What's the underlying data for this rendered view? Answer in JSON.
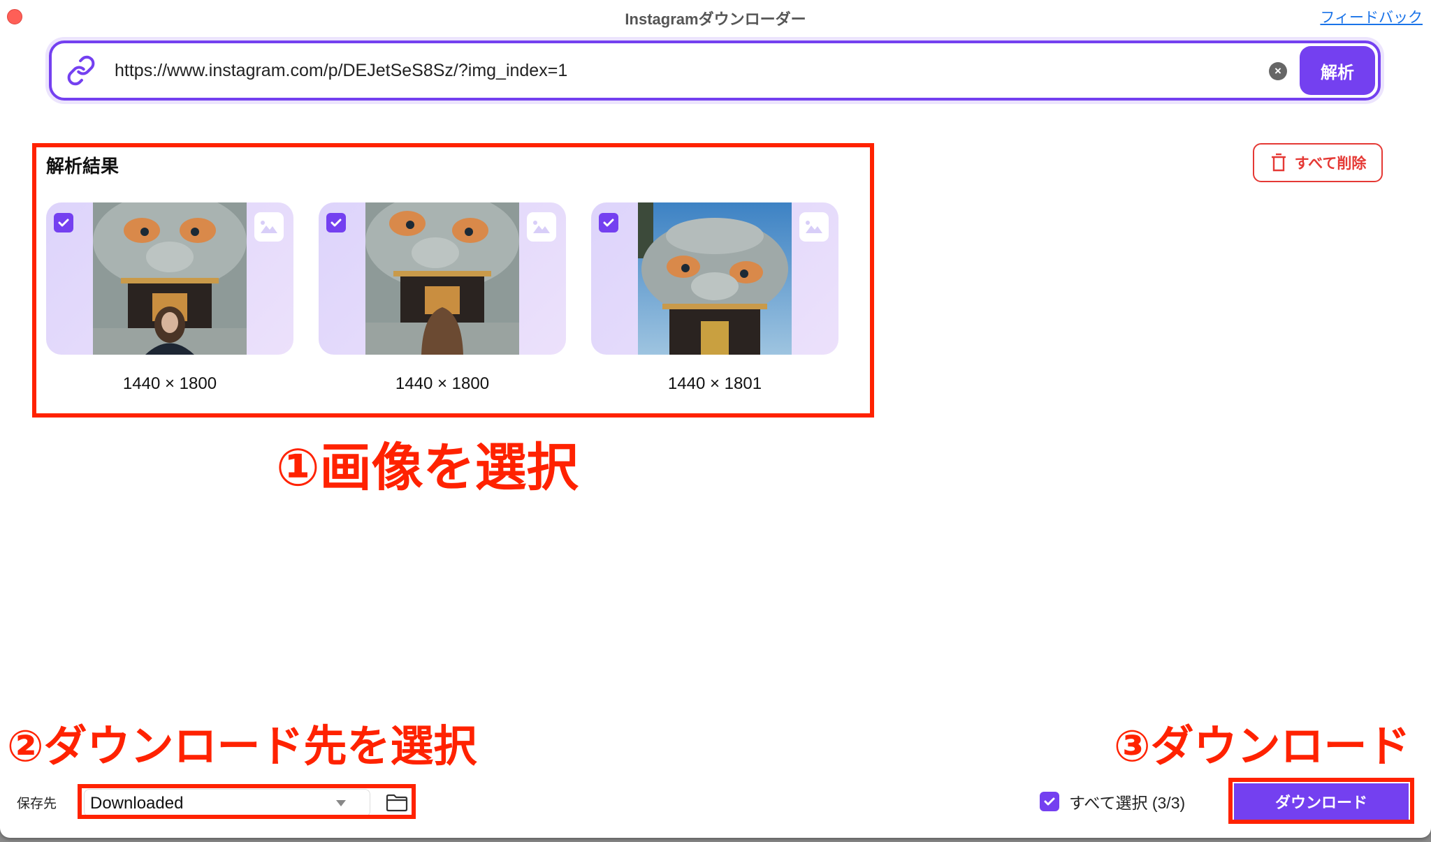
{
  "window": {
    "title": "Instagramダウンローダー",
    "feedback_link": "フィードバック"
  },
  "url_bar": {
    "icon": "link-icon",
    "value": "https://www.instagram.com/p/DEJetSeS8Sz/?img_index=1",
    "clear_icon": "clear-icon",
    "analyze_label": "解析"
  },
  "results": {
    "title": "解析結果",
    "delete_all_label": "すべて削除",
    "delete_icon": "trash-icon",
    "items": [
      {
        "dimensions": "1440 × 1800",
        "checked": true,
        "type_icon": "image-icon",
        "subject": "shishi lion-head shrine with woman facing camera"
      },
      {
        "dimensions": "1440 × 1800",
        "checked": true,
        "type_icon": "image-icon",
        "subject": "shishi lion-head shrine with woman facing away"
      },
      {
        "dimensions": "1440 × 1801",
        "checked": true,
        "type_icon": "image-icon",
        "subject": "shishi lion-head shrine against blue sky"
      }
    ]
  },
  "annotations": {
    "step1": "①画像を選択",
    "step2": "②ダウンロード先を選択",
    "step3": "③ダウンロード",
    "color": "#ff2200"
  },
  "footer": {
    "save_label": "保存先",
    "save_location": "Downloaded",
    "folder_icon": "folder-icon",
    "select_all_label": "すべて選択 (3/3)",
    "select_all_checked": true,
    "selected_count": 3,
    "total_count": 3,
    "download_label": "ダウンロード"
  },
  "colors": {
    "accent": "#7440f0",
    "danger": "#e53935",
    "card_bg": "#ddd4fb",
    "link": "#1a73e8"
  }
}
